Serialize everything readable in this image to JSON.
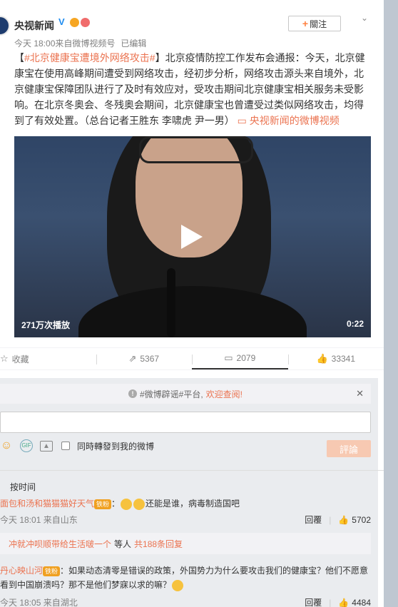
{
  "post": {
    "author": "央视新闻",
    "meta_time": "今天 18:00",
    "meta_source": "来自微博视频号",
    "meta_edited": "已编辑",
    "follow_label": "關注",
    "text_prefix": "【",
    "hashtag": "#北京健康宝遭境外网络攻击#",
    "text_body": "】北京疫情防控工作发布会通报：今天，北京健康宝在使用高峰期间遭受到网络攻击，经初步分析，网络攻击源头来自境外，北京健康宝保障团队进行了及时有效应对，受攻击期间北京健康宝相关服务未受影响。在北京冬奥会、冬残奥会期间，北京健康宝也曾遭受过类似网络攻击，均得到了有效处置。（总台记者王胜东 李啸虎 尹一男）",
    "video_link": "央视新闻的微博视频"
  },
  "video": {
    "views": "271万次播放",
    "duration": "0:22"
  },
  "actions": {
    "favorite_label": "收藏",
    "repost_count": "5367",
    "comment_count": "2079",
    "like_count": "33341"
  },
  "comments_section": {
    "notice_prefix": "#微博辟谣#平台,",
    "notice_link": "欢迎查阅!",
    "checkbox_label": "同時轉發到我的微博",
    "submit_label": "評論",
    "sort_label": "按时间",
    "comments": [
      {
        "name": "面包和汤和猫猫猫好天气",
        "fan_badge": "铁粉",
        "text": "还能是谁，病毒制造国吧",
        "time": "今天 18:01 来自山东",
        "reply_label": "回覆",
        "likes": "5702"
      },
      {
        "name": "丹心映山河",
        "fan_badge": "铁粉",
        "text": "如果动态清零是错误的政策，外国势力为什么要攻击我们的健康宝？他们不愿意看到中国崩溃吗？那不是他们梦寐以求的嘛？",
        "time": "今天 18:05 来自湖北",
        "reply_label": "回覆",
        "likes": "4484"
      }
    ],
    "reply_box": {
      "name": "冲就冲呗顺带给生活啵一个",
      "middle": "等人",
      "count": "共188条回复"
    }
  },
  "colors": {
    "accent": "#eb7350",
    "background": "#bfc7d1"
  }
}
